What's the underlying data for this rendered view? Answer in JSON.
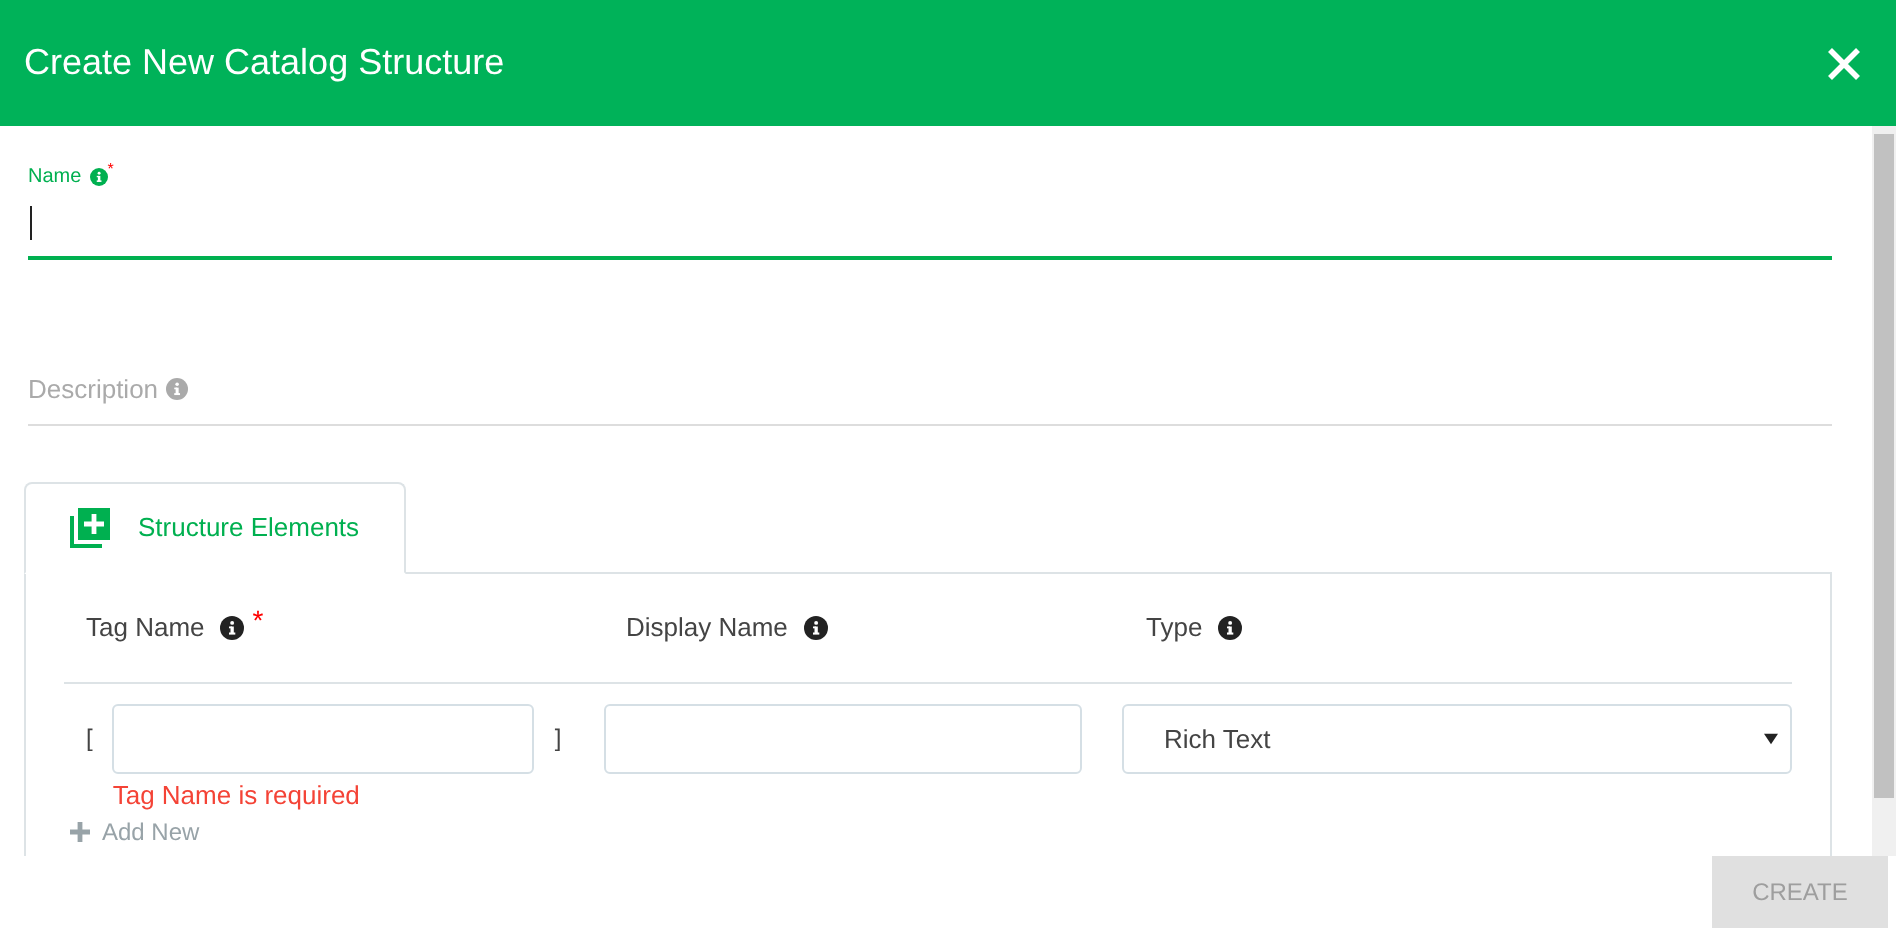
{
  "dialog": {
    "title": "Create New Catalog Structure"
  },
  "fields": [
    {
      "label": "Name",
      "required": true,
      "focused": true
    },
    {
      "label": "Description",
      "required": false,
      "focused": false
    }
  ],
  "tabs": [
    {
      "label": "Structure Elements",
      "selected": true
    }
  ],
  "columns": [
    {
      "label": "Tag Name",
      "required": true
    },
    {
      "label": "Display Name",
      "required": false
    },
    {
      "label": "Type",
      "required": false
    }
  ],
  "row": {
    "open_bracket": "[",
    "close_bracket": "]",
    "error": "Tag Name is required",
    "type_value": "Rich Text"
  },
  "add_new": {
    "label": "Add New"
  },
  "create_button": {
    "label": "CREATE",
    "disabled": true
  },
  "required_mark": "*"
}
